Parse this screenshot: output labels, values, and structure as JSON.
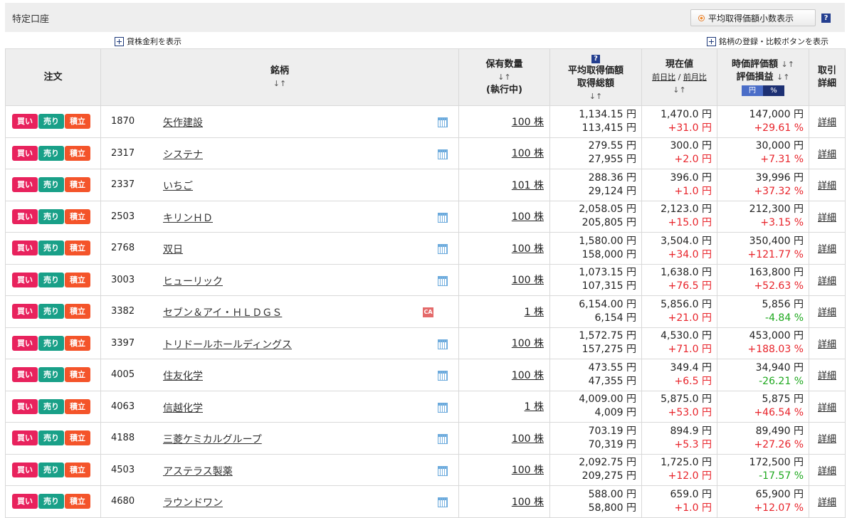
{
  "account": {
    "title": "特定口座",
    "decimal_button_label": "平均取得価額小数表示",
    "help_label": "?"
  },
  "toggles": {
    "lending_rate": "貸株金利を表示",
    "register_compare": "銘柄の登録・比較ボタンを表示"
  },
  "header": {
    "order": "注文",
    "brand": "銘柄",
    "sort_arrow": "↓↑",
    "qty_line1": "保有数量",
    "qty_line3": "(執行中)",
    "avg_line1": "平均取得価額",
    "avg_line2": "取得総額",
    "price_line1": "現在値",
    "price_prev_day": "前日比",
    "price_sep": " / ",
    "price_prev_month": "前月比",
    "value_line1": "時価評価額",
    "value_line2": "評価損益",
    "unit_yen": "円",
    "unit_pct": "%",
    "detail_line1": "取引",
    "detail_line2": "詳細"
  },
  "buttons": {
    "buy": "買い",
    "sell": "売り",
    "tsumitate": "積立"
  },
  "detail_label": "詳細",
  "icons": {
    "calendar": "calendar-icon",
    "corporate_action": "ca-icon",
    "ca_text": "CA"
  },
  "colors": {
    "buy": "#e8225d",
    "sell": "#19a088",
    "tsumitate": "#f4542a",
    "gain": "#e8232a",
    "loss": "#1ea81e"
  },
  "rows": [
    {
      "code": "1870",
      "name": "矢作建設",
      "icon": "calendar",
      "qty": "100 株",
      "avg": "1,134.15 円",
      "total": "113,415 円",
      "price": "1,470.0 円",
      "change": "+31.0 円",
      "change_sign": "pos",
      "value": "147,000 円",
      "pl": "+29.61 %",
      "pl_sign": "pos"
    },
    {
      "code": "2317",
      "name": "システナ",
      "icon": "calendar",
      "qty": "100 株",
      "avg": "279.55 円",
      "total": "27,955 円",
      "price": "300.0 円",
      "change": "+2.0 円",
      "change_sign": "pos",
      "value": "30,000 円",
      "pl": "+7.31 %",
      "pl_sign": "pos"
    },
    {
      "code": "2337",
      "name": "いちご",
      "icon": "none",
      "qty": "101 株",
      "avg": "288.36 円",
      "total": "29,124 円",
      "price": "396.0 円",
      "change": "+1.0 円",
      "change_sign": "pos",
      "value": "39,996 円",
      "pl": "+37.32 %",
      "pl_sign": "pos"
    },
    {
      "code": "2503",
      "name": "キリンＨＤ",
      "icon": "calendar",
      "qty": "100 株",
      "avg": "2,058.05 円",
      "total": "205,805 円",
      "price": "2,123.0 円",
      "change": "+15.0 円",
      "change_sign": "pos",
      "value": "212,300 円",
      "pl": "+3.15 %",
      "pl_sign": "pos"
    },
    {
      "code": "2768",
      "name": "双日",
      "icon": "calendar",
      "qty": "100 株",
      "avg": "1,580.00 円",
      "total": "158,000 円",
      "price": "3,504.0 円",
      "change": "+34.0 円",
      "change_sign": "pos",
      "value": "350,400 円",
      "pl": "+121.77 %",
      "pl_sign": "pos"
    },
    {
      "code": "3003",
      "name": "ヒューリック",
      "icon": "calendar",
      "qty": "100 株",
      "avg": "1,073.15 円",
      "total": "107,315 円",
      "price": "1,638.0 円",
      "change": "+76.5 円",
      "change_sign": "pos",
      "value": "163,800 円",
      "pl": "+52.63 %",
      "pl_sign": "pos"
    },
    {
      "code": "3382",
      "name": "セブン＆アイ・ＨＬＤＧＳ",
      "icon": "ca",
      "qty": "1 株",
      "avg": "6,154.00 円",
      "total": "6,154 円",
      "price": "5,856.0 円",
      "change": "+21.0 円",
      "change_sign": "pos",
      "value": "5,856 円",
      "pl": "-4.84 %",
      "pl_sign": "neg"
    },
    {
      "code": "3397",
      "name": "トリドールホールディングス",
      "icon": "calendar",
      "qty": "100 株",
      "avg": "1,572.75 円",
      "total": "157,275 円",
      "price": "4,530.0 円",
      "change": "+71.0 円",
      "change_sign": "pos",
      "value": "453,000 円",
      "pl": "+188.03 %",
      "pl_sign": "pos"
    },
    {
      "code": "4005",
      "name": "住友化学",
      "icon": "calendar",
      "qty": "100 株",
      "avg": "473.55 円",
      "total": "47,355 円",
      "price": "349.4 円",
      "change": "+6.5 円",
      "change_sign": "pos",
      "value": "34,940 円",
      "pl": "-26.21 %",
      "pl_sign": "neg"
    },
    {
      "code": "4063",
      "name": "信越化学",
      "icon": "calendar",
      "qty": "1 株",
      "avg": "4,009.00 円",
      "total": "4,009 円",
      "price": "5,875.0 円",
      "change": "+53.0 円",
      "change_sign": "pos",
      "value": "5,875 円",
      "pl": "+46.54 %",
      "pl_sign": "pos"
    },
    {
      "code": "4188",
      "name": "三菱ケミカルグループ",
      "icon": "calendar",
      "qty": "100 株",
      "avg": "703.19 円",
      "total": "70,319 円",
      "price": "894.9 円",
      "change": "+5.3 円",
      "change_sign": "pos",
      "value": "89,490 円",
      "pl": "+27.26 %",
      "pl_sign": "pos"
    },
    {
      "code": "4503",
      "name": "アステラス製薬",
      "icon": "calendar",
      "qty": "100 株",
      "avg": "2,092.75 円",
      "total": "209,275 円",
      "price": "1,725.0 円",
      "change": "+12.0 円",
      "change_sign": "pos",
      "value": "172,500 円",
      "pl": "-17.57 %",
      "pl_sign": "neg"
    },
    {
      "code": "4680",
      "name": "ラウンドワン",
      "icon": "calendar",
      "qty": "100 株",
      "avg": "588.00 円",
      "total": "58,800 円",
      "price": "659.0 円",
      "change": "+1.0 円",
      "change_sign": "pos",
      "value": "65,900 円",
      "pl": "+12.07 %",
      "pl_sign": "pos"
    }
  ]
}
